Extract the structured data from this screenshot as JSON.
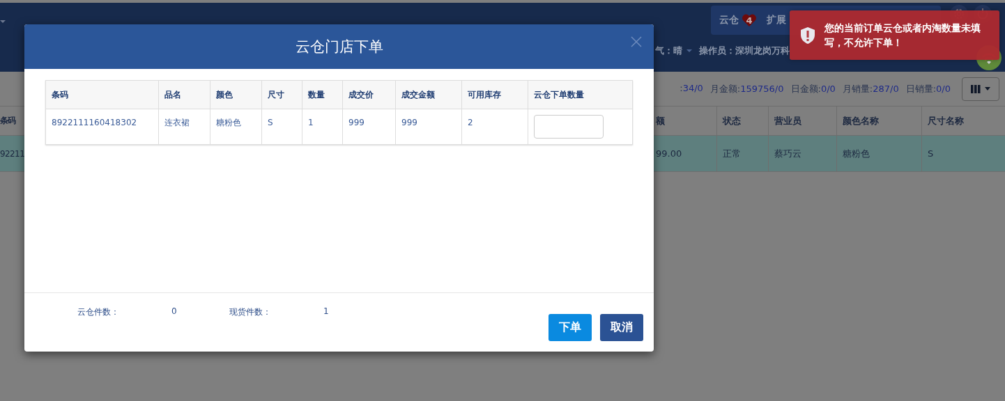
{
  "nav": {
    "menu": [
      {
        "label": "云仓",
        "badge": "4"
      },
      {
        "label": "扩展"
      }
    ],
    "weather": "气：晴",
    "operator": "操作员：深圳龙岗万科"
  },
  "stats": [
    {
      "label": ":",
      "value": "34/0"
    },
    {
      "label": "月金额:",
      "value": "159756/0"
    },
    {
      "label": "日金额:",
      "value": "0/0"
    },
    {
      "label": "月销量:",
      "value": "287/0"
    },
    {
      "label": "日销量:",
      "value": "0/0"
    }
  ],
  "background_table": {
    "columns": [
      "条码",
      "额",
      "状态",
      "营业员",
      "颜色名称",
      "尺寸名称"
    ],
    "rows": [
      {
        "cells": [
          "92211",
          "99.00",
          "正常",
          "蔡巧云",
          "糖粉色",
          "S"
        ],
        "selected": true
      }
    ]
  },
  "modal": {
    "title": "云仓门店下单",
    "table": {
      "columns": [
        "条码",
        "品名",
        "颜色",
        "尺寸",
        "数量",
        "成交价",
        "成交金额",
        "可用库存",
        "云仓下单数量"
      ],
      "rows": [
        {
          "cells": [
            "8922111160418302",
            "连衣裙",
            "糖粉色",
            "S",
            "1",
            "999",
            "999",
            "2"
          ]
        }
      ]
    },
    "footer": {
      "cloud_count_label": "云仓件数：",
      "cloud_count": "0",
      "stock_count_label": "现货件数：",
      "stock_count": "1"
    },
    "buttons": [
      {
        "label": "下单",
        "kind": "primary"
      },
      {
        "label": "取消",
        "kind": "secondary"
      }
    ]
  },
  "toast": {
    "message": "您的当前订单云仓或者内淘数量未填写，不允许下单！"
  }
}
